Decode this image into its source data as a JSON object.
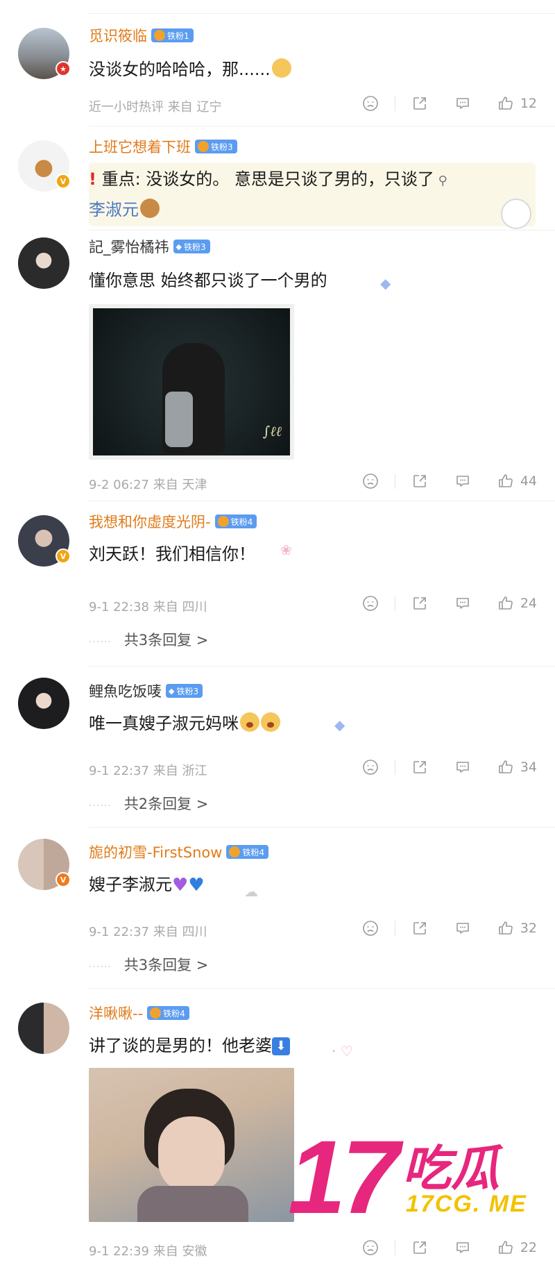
{
  "comments": [
    {
      "username": "觅识筱临",
      "fan_badge": "铁粉1",
      "text": "没谈女的哈哈哈，那......",
      "time": "近一小时热评",
      "location": "来自 辽宁",
      "likes": "12"
    },
    {
      "username": "上班它想着下班",
      "fan_badge": "铁粉3",
      "text_line1": "重点: 没谈女的。  意思是只谈了男的，只谈了",
      "text_line2": "李淑元"
    },
    {
      "username": "記_雾怡橘祎",
      "fan_badge": "铁粉3",
      "text": "懂你意思 始终都只谈了一个男的",
      "time": "9-2 06:27",
      "location": "来自 天津",
      "likes": "44"
    },
    {
      "username": "我想和你虚度光阴-",
      "fan_badge": "铁粉4",
      "text": "刘天跃！我们相信你！",
      "time": "9-1 22:38",
      "location": "来自 四川",
      "likes": "24",
      "replies": "共3条回复 >"
    },
    {
      "username": "鲤魚吃饭唛",
      "fan_badge": "铁粉3",
      "text": "唯一真嫂子淑元妈咪",
      "time": "9-1 22:37",
      "location": "来自 浙江",
      "likes": "34",
      "replies": "共2条回复 >"
    },
    {
      "username": "旎的初雪-FirstSnow",
      "fan_badge": "铁粉4",
      "text": "嫂子李淑元",
      "time": "9-1 22:37",
      "location": "来自 四川",
      "likes": "32",
      "replies": "共3条回复 >"
    },
    {
      "username": "洋啾啾--",
      "fan_badge": "铁粉4",
      "text": "讲了谈的是男的！他老婆",
      "time": "9-1 22:39",
      "location": "来自 安徽",
      "likes": "22"
    }
  ],
  "watermark": {
    "number": "17",
    "brand": "吃瓜",
    "site": "17CG. ME"
  }
}
